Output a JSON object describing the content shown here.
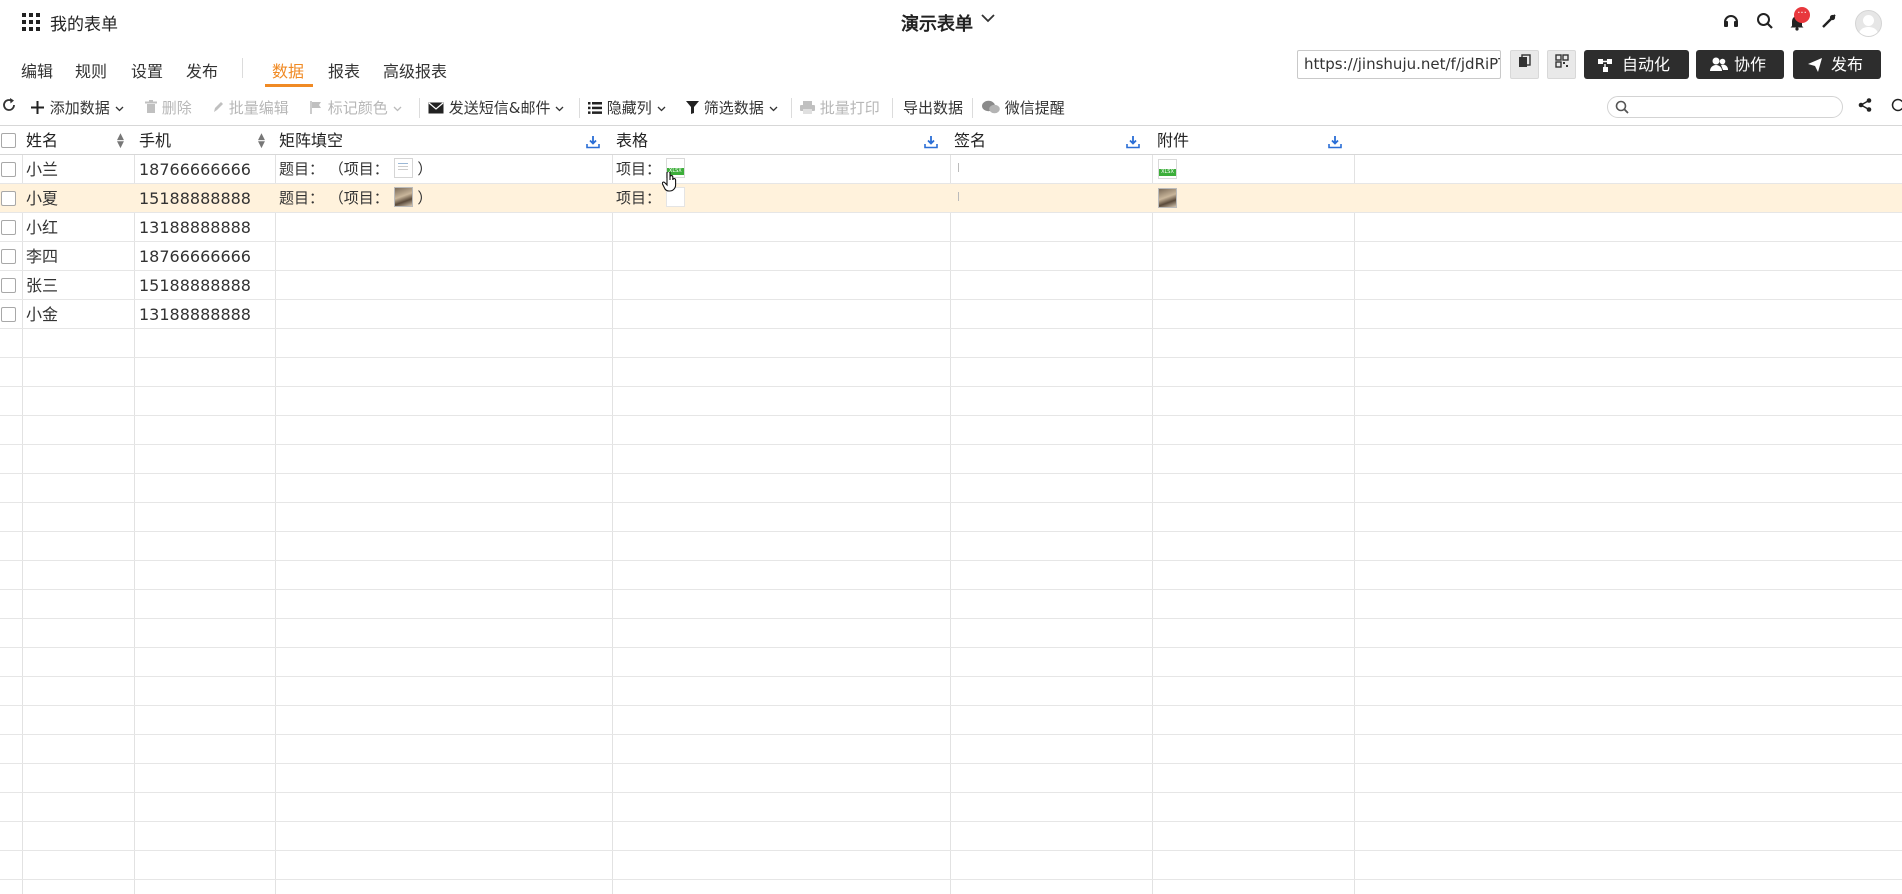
{
  "header": {
    "app_title": "我的表单",
    "form_title": "演示表单",
    "notification_badge": "···"
  },
  "nav": {
    "left_items": [
      "编辑",
      "规则",
      "设置",
      "发布"
    ],
    "right_items": [
      "数据",
      "报表",
      "高级报表"
    ],
    "active": "数据"
  },
  "actions": {
    "url_value": "https://jinshuju.net/f/jdRiPT",
    "automation_label": "自动化",
    "collaborate_label": "协作",
    "publish_label": "发布"
  },
  "toolbar": {
    "add_data": "添加数据",
    "delete": "删除",
    "batch_edit": "批量编辑",
    "mark_color": "标记颜色",
    "send_sms_email": "发送短信&邮件",
    "hide_columns": "隐藏列",
    "filter_data": "筛选数据",
    "batch_print": "批量打印",
    "export_data": "导出数据",
    "wechat_remind": "微信提醒",
    "search_placeholder": ""
  },
  "table": {
    "columns": [
      "姓名",
      "手机",
      "矩阵填空",
      "表格",
      "签名",
      "附件"
    ],
    "rows": [
      {
        "name": "小兰",
        "phone": "18766666666",
        "matrix_prefix": "题目： （项目：",
        "matrix_suffix": "）",
        "table_prefix": "项目：",
        "selected": false
      },
      {
        "name": "小夏",
        "phone": "15188888888",
        "matrix_prefix": "题目： （项目：",
        "matrix_suffix": "）",
        "table_prefix": "项目：",
        "selected": true
      },
      {
        "name": "小红",
        "phone": "13188888888"
      },
      {
        "name": "李四",
        "phone": "18766666666"
      },
      {
        "name": "张三",
        "phone": "15188888888"
      },
      {
        "name": "小金",
        "phone": "13188888888"
      }
    ]
  },
  "colors": {
    "accent": "#f08a24",
    "selected_row": "#fff2dc",
    "dark_button": "#2d2d2d",
    "badge": "#e8383d"
  }
}
